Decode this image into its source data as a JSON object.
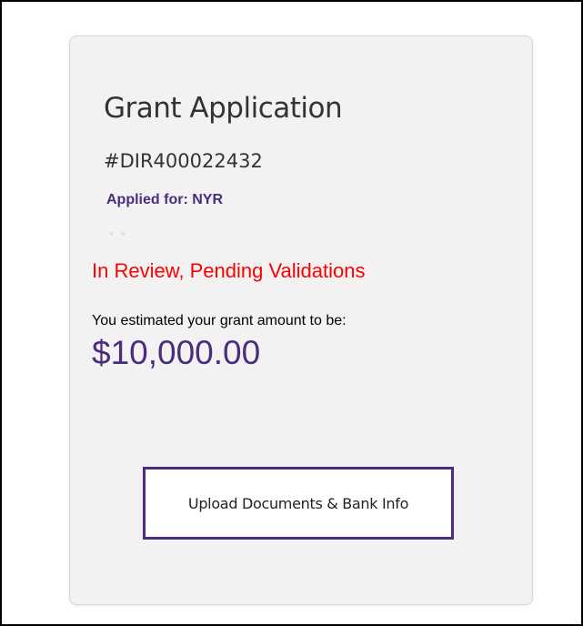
{
  "card": {
    "title": "Grant Application",
    "application_id": "#DIR400022432",
    "applied_for": "Applied for: NYR",
    "status": "In Review, Pending Validations",
    "estimate_label": "You estimated your grant amount to be:",
    "amount": "$10,000.00",
    "upload_button_label": "Upload Documents & Bank Info"
  },
  "colors": {
    "accent": "#4a2d7d",
    "status": "#ff0000",
    "card_background": "#f2f2f2"
  }
}
